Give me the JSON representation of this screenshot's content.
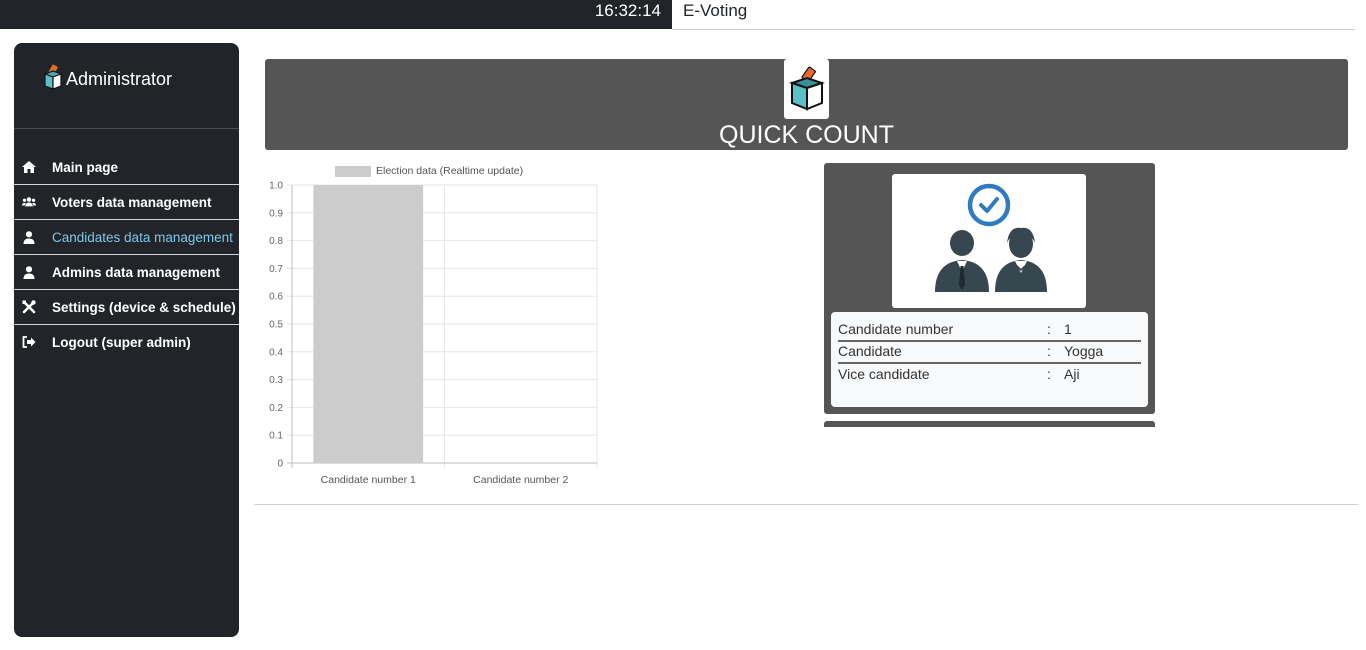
{
  "topbar": {
    "clock": "16:32:14",
    "app_title": "E-Voting"
  },
  "sidebar": {
    "brand": {
      "label": "Administrator",
      "icon": "ballot-box-icon"
    },
    "items": [
      {
        "label": "Main page",
        "icon": "home-icon",
        "active": false
      },
      {
        "label": "Voters data management",
        "icon": "users-icon",
        "active": false
      },
      {
        "label": "Candidates data management",
        "icon": "user-icon",
        "active": true
      },
      {
        "label": "Admins data management",
        "icon": "user-icon",
        "active": false
      },
      {
        "label": "Settings (device & schedule)",
        "icon": "tools-icon",
        "active": false
      },
      {
        "label": "Logout (super admin)",
        "icon": "sign-out-icon",
        "active": false
      }
    ],
    "active_color": "#7fc7ec"
  },
  "banner": {
    "title": "QUICK COUNT",
    "icon": "ballot-box-icon"
  },
  "chart_data": {
    "type": "bar",
    "categories": [
      "Candidate number 1",
      "Candidate number 2"
    ],
    "series": [
      {
        "name": "Election data (Realtime update)",
        "values": [
          1,
          0
        ]
      }
    ],
    "yticks": [
      "0",
      "0.1",
      "0.2",
      "0.3",
      "0.4",
      "0.5",
      "0.6",
      "0.7",
      "0.8",
      "0.9",
      "1.0"
    ],
    "ylim": [
      0,
      1
    ],
    "grid": true,
    "legend_position": "top",
    "bar_color": "#cccccc"
  },
  "candidates": [
    {
      "image_icon": "candidate-pair-icon",
      "rows": [
        {
          "label": "Candidate number",
          "colon": ":",
          "value": "1"
        },
        {
          "label": "Candidate",
          "colon": ":",
          "value": "Yogga"
        },
        {
          "label": "Vice candidate",
          "colon": ":",
          "value": "Aji"
        }
      ]
    }
  ],
  "colors": {
    "dark": "#212529",
    "panel": "#555555",
    "accent": "#e8692e",
    "icon_teal": "#5bbfc8",
    "icon_blue": "#2e7bbf"
  }
}
